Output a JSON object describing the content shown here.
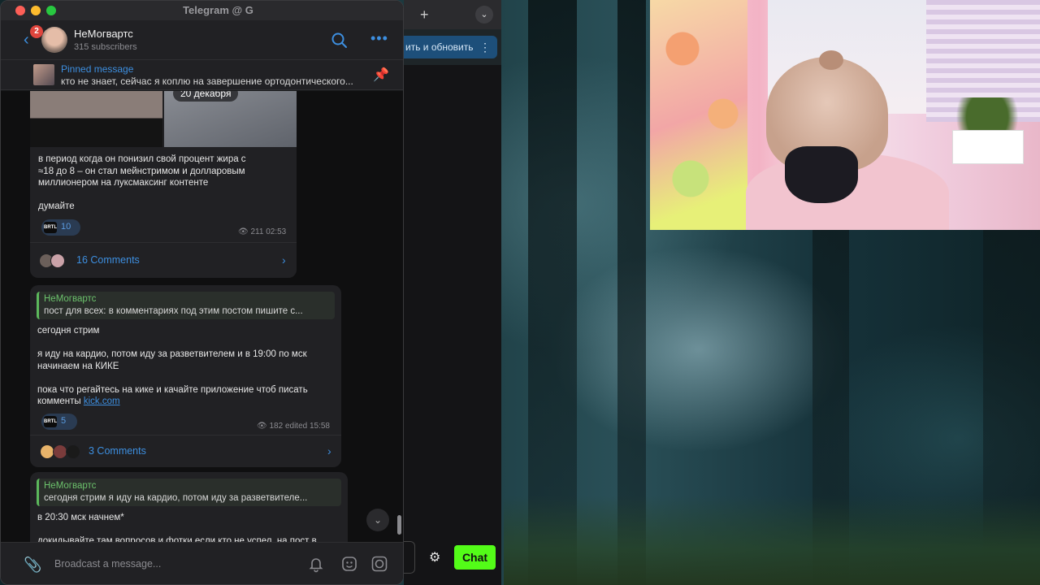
{
  "telegram": {
    "window_title": "Telegram @ G",
    "channel": {
      "name": "НеМогвартс",
      "subscribers": "315 subscribers",
      "unread_badge": "2"
    },
    "pinned": {
      "title": "Pinned message",
      "text": "кто не знает, сейчас я коплю на завершение ортодонтического..."
    },
    "messages": [
      {
        "date_chip": "20 декабря",
        "text": "в период когда он понизил свой процент жира с\n≈18 до 8 – он стал мейнстримом и долларовым\nмиллионером на луксмаксинг контенте\n\nдумайте",
        "reaction_count": "10",
        "reaction_label": "BRTL",
        "meta": "211 02:53",
        "comments": "16 Comments"
      },
      {
        "quote_author": "НеМогвартс",
        "quote_text": "пост для всех:   в комментариях под этим постом пишите с...",
        "text_part1": "сегодня стрим\n\nя иду на кардио, потом иду за разветвителем и в 19:00 по мск\nначинаем на КИКЕ\n\nпока что регайтесь на кике и качайте приложение чтоб писать\nкомменты ",
        "link": "kick.com",
        "reaction_count": "5",
        "reaction_label": "BRTL",
        "meta": "182 edited 15:58",
        "comments": "3 Comments"
      },
      {
        "quote_author": "НеМогвартс",
        "quote_text": "сегодня стрим  я иду на кардио, потом иду за разветвителе...",
        "text": "в 20:30 мск начнем*\n\nдокидывайте там вопросов и фотки если кто не успел, на пост в"
      }
    ],
    "composer": {
      "placeholder": "Broadcast a message..."
    }
  },
  "browser": {
    "new_tab": "+",
    "share_button": "ить и обновить",
    "chat_button": "Chat"
  },
  "colors": {
    "accent": "#3d8fe0",
    "quote_green": "#5cb85c",
    "kick_green": "#53fc18"
  }
}
